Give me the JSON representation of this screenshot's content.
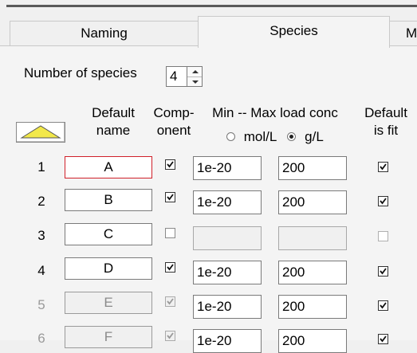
{
  "tabs": [
    {
      "label": "Naming",
      "active": false
    },
    {
      "label": "Species",
      "active": true
    },
    {
      "label": "M",
      "active": false
    }
  ],
  "number_of_species": {
    "label": "Number of species",
    "value": "4"
  },
  "headers": {
    "default_name_1": "Default",
    "default_name_2": "name",
    "component_1": "Comp-",
    "component_2": "onent",
    "load_conc": "Min -- Max load conc",
    "unit_mol": "mol/L",
    "unit_g": "g/L",
    "default_fit_1": "Default",
    "default_fit_2": "is fit"
  },
  "units_selected": "g/L",
  "rows": [
    {
      "num": "1",
      "name": "A",
      "component": true,
      "min": "1e-20",
      "max": "200",
      "is_fit": true,
      "enabled": true,
      "selected": true
    },
    {
      "num": "2",
      "name": "B",
      "component": true,
      "min": "1e-20",
      "max": "200",
      "is_fit": true,
      "enabled": true,
      "selected": false
    },
    {
      "num": "3",
      "name": "C",
      "component": false,
      "min": "",
      "max": "",
      "is_fit": false,
      "enabled": true,
      "selected": false
    },
    {
      "num": "4",
      "name": "D",
      "component": true,
      "min": "1e-20",
      "max": "200",
      "is_fit": true,
      "enabled": true,
      "selected": false
    },
    {
      "num": "5",
      "name": "E",
      "component": true,
      "min": "1e-20",
      "max": "200",
      "is_fit": true,
      "enabled": false,
      "selected": false
    },
    {
      "num": "6",
      "name": "F",
      "component": true,
      "min": "1e-20",
      "max": "200",
      "is_fit": true,
      "enabled": false,
      "selected": false
    }
  ],
  "colors": {
    "selected_border": "#d0202a",
    "sort_arrow_fill": "#f2e84a"
  },
  "icons": {
    "sort": "sort-up-triangle-icon",
    "spinner": "spinner-arrows-icon",
    "check": "check-mark-icon"
  }
}
